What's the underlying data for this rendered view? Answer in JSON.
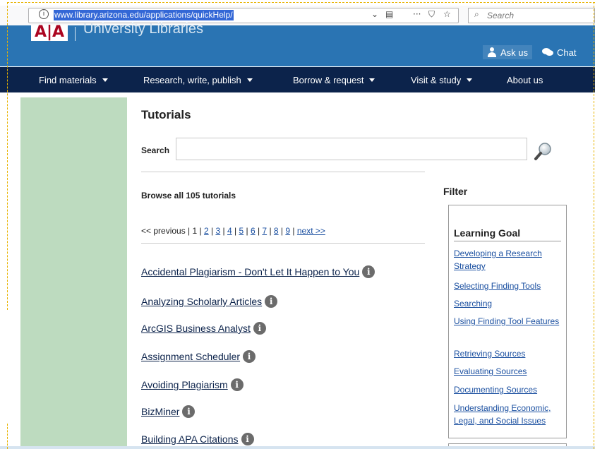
{
  "browser": {
    "url": "www.library.arizona.edu/applications/quickHelp/",
    "search_placeholder": "Search",
    "icons": [
      "info-icon",
      "chevron-down-icon",
      "reader-icon",
      "more-icon",
      "pocket-icon",
      "star-icon",
      "search-icon"
    ]
  },
  "header": {
    "logo_text": "University Libraries",
    "ask_us": "Ask us",
    "chat": "Chat"
  },
  "nav": {
    "items": [
      {
        "label": "Find materials",
        "dropdown": true
      },
      {
        "label": "Research, write, publish",
        "dropdown": true
      },
      {
        "label": "Borrow & request",
        "dropdown": true
      },
      {
        "label": "Visit & study",
        "dropdown": true
      },
      {
        "label": "About us",
        "dropdown": false
      }
    ]
  },
  "main": {
    "title": "Tutorials",
    "search_label": "Search",
    "browse_heading": "Browse all 105 tutorials",
    "pager": {
      "previous": "<< previous",
      "current": "1",
      "pages": [
        "2",
        "3",
        "4",
        "5",
        "6",
        "7",
        "8",
        "9"
      ],
      "next": "next >>"
    },
    "tutorials": [
      "Accidental Plagiarism - Don't Let It Happen to You",
      "Analyzing Scholarly Articles",
      "ArcGIS Business Analyst",
      "Assignment Scheduler",
      "Avoiding Plagiarism",
      "BizMiner",
      "Building APA Citations"
    ]
  },
  "filter": {
    "title": "Filter",
    "learning_goal": "Learning Goal",
    "links": [
      "Developing a Research Strategy",
      "Selecting Finding Tools",
      "Searching",
      "Using Finding Tool Features",
      "Retrieving Sources",
      "Evaluating Sources",
      "Documenting Sources",
      "Understanding Economic, Legal, and Social Issues"
    ]
  },
  "colors": {
    "header_blue": "#2a74b3",
    "nav_navy": "#0c234b",
    "rail_green": "#bddbbf",
    "arizona_red": "#ab0520"
  }
}
